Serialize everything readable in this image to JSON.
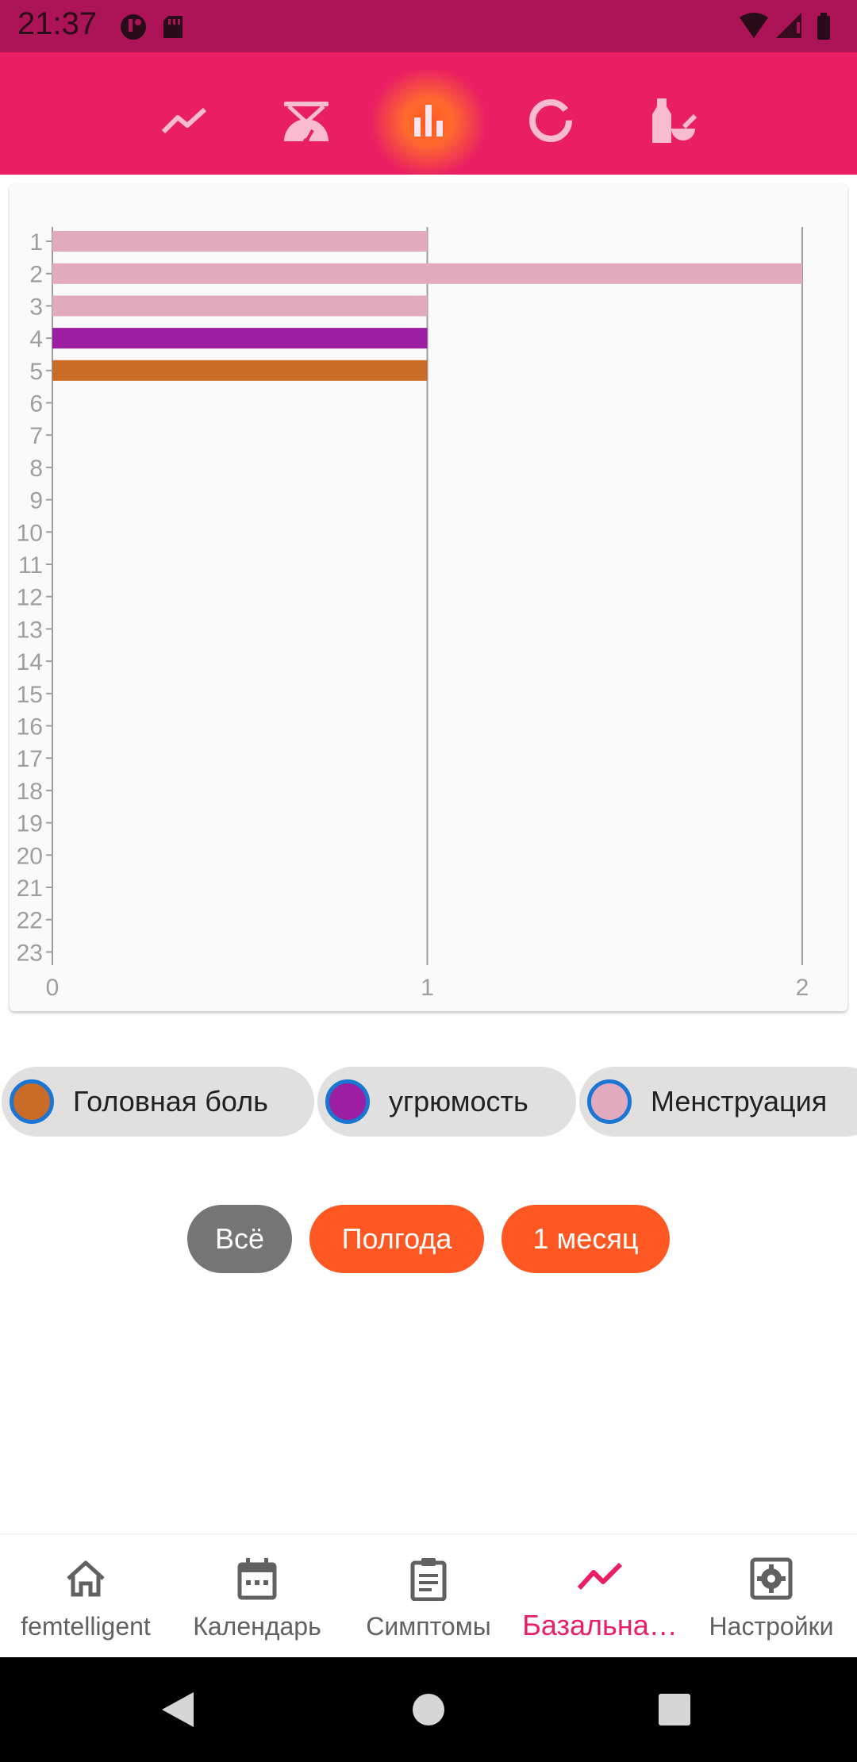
{
  "status_bar": {
    "time": "21:37"
  },
  "top_tabs": [
    {
      "icon": "trend-line-icon"
    },
    {
      "icon": "scale-icon"
    },
    {
      "icon": "bar-chart-icon",
      "active": true
    },
    {
      "icon": "donut-chart-icon"
    },
    {
      "icon": "mortar-pestle-icon"
    }
  ],
  "chart_data": {
    "type": "bar",
    "orientation": "horizontal",
    "categories": [
      "1",
      "2",
      "3",
      "4",
      "5",
      "6",
      "7",
      "8",
      "9",
      "10",
      "11",
      "12",
      "13",
      "14",
      "15",
      "16",
      "17",
      "18",
      "19",
      "20",
      "21",
      "22",
      "23"
    ],
    "values": [
      1,
      2,
      1,
      1,
      1,
      0,
      0,
      0,
      0,
      0,
      0,
      0,
      0,
      0,
      0,
      0,
      0,
      0,
      0,
      0,
      0,
      0,
      0
    ],
    "bar_colors": [
      "#e1abbd",
      "#e1abbd",
      "#e1abbd",
      "#9c1ea3",
      "#c96c27"
    ],
    "x_ticks": [
      "0",
      "1",
      "2"
    ],
    "xlim": [
      0,
      2
    ],
    "grid": true,
    "legend_placement": "bottom"
  },
  "legend": [
    {
      "label": "Головная боль",
      "color": "#c96c27"
    },
    {
      "label": "угрюмость",
      "color": "#9c1ea3"
    },
    {
      "label": "Менструация",
      "color": "#e1abbd"
    }
  ],
  "range_buttons": [
    {
      "label": "Всё",
      "color": "#757575"
    },
    {
      "label": "Полгода",
      "color": "#ff5722"
    },
    {
      "label": "1 месяц",
      "color": "#ff5722"
    }
  ],
  "bottom_nav": [
    {
      "label": "femtelligent",
      "icon": "home-icon"
    },
    {
      "label": "Календарь",
      "icon": "calendar-icon"
    },
    {
      "label": "Симптомы",
      "icon": "clipboard-icon"
    },
    {
      "label": "Базальна…",
      "icon": "trend-line-icon",
      "active": true
    },
    {
      "label": "Настройки",
      "icon": "settings-icon"
    }
  ]
}
